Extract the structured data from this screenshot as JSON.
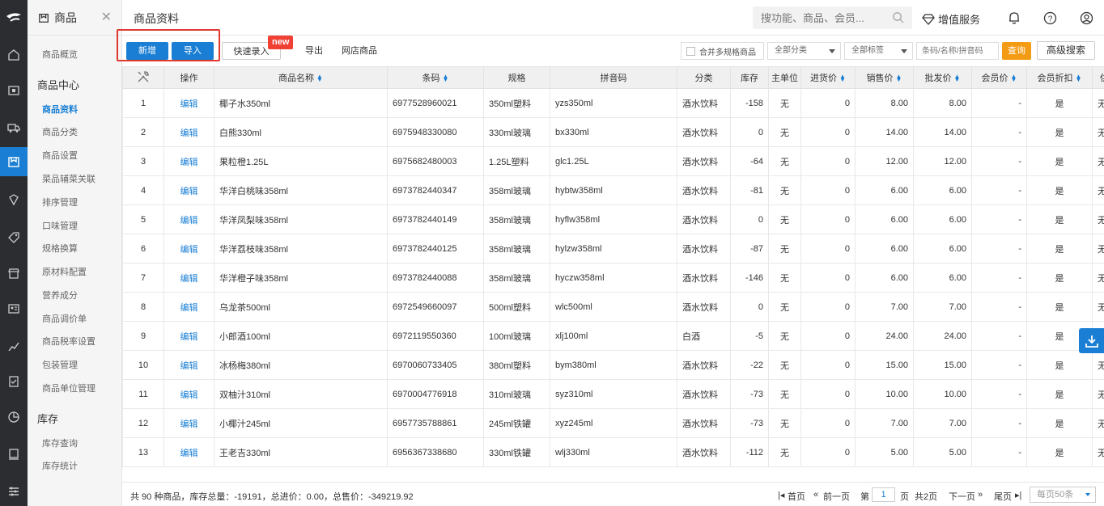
{
  "nav": {
    "module_title": "商品",
    "items_top": [
      "商品概览"
    ],
    "group_center": "商品中心",
    "center_items": [
      "商品资料",
      "商品分类",
      "商品设置",
      "菜品辅菜关联",
      "排序管理",
      "口味管理",
      "规格换算",
      "原材料配置",
      "营养成分",
      "商品调价单",
      "商品税率设置",
      "包装管理",
      "商品单位管理"
    ],
    "active_item": "商品资料",
    "group_stock": "库存",
    "stock_items": [
      "库存查询",
      "库存统计"
    ]
  },
  "header": {
    "title": "商品资料",
    "search_placeholder": "搜功能、商品、会员...",
    "value_added": "增值服务"
  },
  "toolbar": {
    "add": "新增",
    "import": "导入",
    "quick_entry": "快速录入",
    "new_badge": "new",
    "export": "导出",
    "online_goods": "网店商品",
    "merge_label": "合并多规格商品",
    "category_select": "全部分类",
    "tag_select": "全部标签",
    "keyword_placeholder": "条码/名称/拼音码",
    "query": "查询",
    "advanced": "高级搜索"
  },
  "table": {
    "columns": [
      "",
      "操作",
      "商品名称",
      "条码",
      "规格",
      "拼音码",
      "分类",
      "库存",
      "主单位",
      "进货价",
      "销售价",
      "批发价",
      "会员价",
      "会员折扣",
      "供"
    ],
    "rows": [
      [
        "1",
        "编辑",
        "椰子水350ml",
        "6977528960021",
        "350ml塑料",
        "yzs350ml",
        "酒水饮料",
        "-158",
        "无",
        "0",
        "8.00",
        "8.00",
        "-",
        "是",
        "无"
      ],
      [
        "2",
        "编辑",
        "白熊330ml",
        "6975948330080",
        "330ml玻璃",
        "bx330ml",
        "酒水饮料",
        "0",
        "无",
        "0",
        "14.00",
        "14.00",
        "-",
        "是",
        "无"
      ],
      [
        "3",
        "编辑",
        "果粒橙1.25L",
        "6975682480003",
        "1.25L塑料",
        "glc1.25L",
        "酒水饮料",
        "-64",
        "无",
        "0",
        "12.00",
        "12.00",
        "-",
        "是",
        "无"
      ],
      [
        "4",
        "编辑",
        "华洋白桃味358ml",
        "6973782440347",
        "358ml玻璃",
        "hybtw358ml",
        "酒水饮料",
        "-81",
        "无",
        "0",
        "6.00",
        "6.00",
        "-",
        "是",
        "无"
      ],
      [
        "5",
        "编辑",
        "华洋凤梨味358ml",
        "6973782440149",
        "358ml玻璃",
        "hyflw358ml",
        "酒水饮料",
        "0",
        "无",
        "0",
        "6.00",
        "6.00",
        "-",
        "是",
        "无"
      ],
      [
        "6",
        "编辑",
        "华洋荔枝味358ml",
        "6973782440125",
        "358ml玻璃",
        "hylzw358ml",
        "酒水饮料",
        "-87",
        "无",
        "0",
        "6.00",
        "6.00",
        "-",
        "是",
        "无"
      ],
      [
        "7",
        "编辑",
        "华洋橙子味358ml",
        "6973782440088",
        "358ml玻璃",
        "hyczw358ml",
        "酒水饮料",
        "-146",
        "无",
        "0",
        "6.00",
        "6.00",
        "-",
        "是",
        "无"
      ],
      [
        "8",
        "编辑",
        "乌龙茶500ml",
        "6972549660097",
        "500ml塑料",
        "wlc500ml",
        "酒水饮料",
        "0",
        "无",
        "0",
        "7.00",
        "7.00",
        "-",
        "是",
        "无"
      ],
      [
        "9",
        "编辑",
        "小郎酒100ml",
        "6972119550360",
        "100ml玻璃",
        "xlj100ml",
        "白酒",
        "-5",
        "无",
        "0",
        "24.00",
        "24.00",
        "-",
        "是",
        "无"
      ],
      [
        "10",
        "编辑",
        "冰杨梅380ml",
        "6970060733405",
        "380ml塑料",
        "bym380ml",
        "酒水饮料",
        "-22",
        "无",
        "0",
        "15.00",
        "15.00",
        "-",
        "是",
        "无"
      ],
      [
        "11",
        "编辑",
        "双柚汁310ml",
        "6970004776918",
        "310ml玻璃",
        "syz310ml",
        "酒水饮料",
        "-73",
        "无",
        "0",
        "10.00",
        "10.00",
        "-",
        "是",
        "无"
      ],
      [
        "12",
        "编辑",
        "小椰汁245ml",
        "6957735788861",
        "245ml铁罐",
        "xyz245ml",
        "酒水饮料",
        "-73",
        "无",
        "0",
        "7.00",
        "7.00",
        "-",
        "是",
        "无"
      ],
      [
        "13",
        "编辑",
        "王老吉330ml",
        "6956367338680",
        "330ml铁罐",
        "wlj330ml",
        "酒水饮料",
        "-112",
        "无",
        "0",
        "5.00",
        "5.00",
        "-",
        "是",
        "无"
      ]
    ]
  },
  "footer": {
    "summary": "共 90 种商品，库存总量：-19191，总进价：0.00，总售价：-349219.92",
    "first": "首页",
    "prev": "前一页",
    "page_prefix": "第",
    "page_value": "1",
    "page_suffix": "页",
    "total_pages": "共2页",
    "next": "下一页",
    "last": "尾页",
    "per_page": "每页50条"
  },
  "colors": {
    "accent": "#1a7fd4",
    "query": "#f49b14",
    "badge": "#f04134",
    "rail": "#2b2d31"
  }
}
